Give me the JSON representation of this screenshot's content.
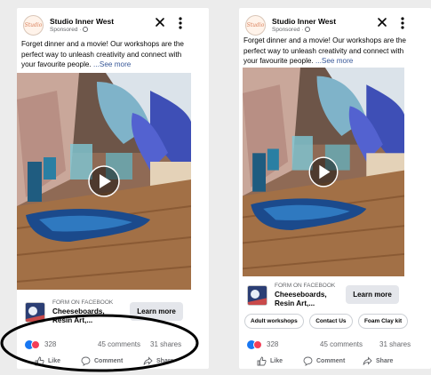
{
  "colors": {
    "page_bg": "#ececec",
    "card_bg": "#ffffff",
    "link": "#385898",
    "muted": "#65676b",
    "button_bg": "#e4e6eb",
    "like_blue": "#1877f2",
    "love_red": "#f33e58",
    "annotation": "#000000"
  },
  "ad_left": {
    "page_name": "Studio Inner West",
    "sponsored": "Sponsored ·",
    "logo_text": "Studio",
    "caption": "Forget dinner and a movie! Our workshops are the perfect way to unleash creativity and connect with your favourite people.",
    "see_more": "...See more",
    "form_source": "FORM ON FACEBOOK",
    "form_title": "Cheeseboards, Resin Art,...",
    "learn_more": "Learn more",
    "reaction_count": "328",
    "comments": "45 comments",
    "shares": "31 shares",
    "like_label": "Like",
    "comment_label": "Comment",
    "share_label": "Share"
  },
  "ad_right": {
    "page_name": "Studio Inner West",
    "sponsored": "Sponsored ·",
    "logo_text": "Studio",
    "caption": "Forget dinner and a movie! Our workshops are the perfect way to unleash creativity and connect with your favourite people.",
    "see_more": "...See more",
    "form_source": "FORM ON FACEBOOK",
    "form_title": "Cheeseboards, Resin Art,...",
    "learn_more": "Learn more",
    "chips": [
      "Adult workshops",
      "Contact Us",
      "Foam Clay kit"
    ],
    "reaction_count": "328",
    "comments": "45 comments",
    "shares": "31 shares",
    "like_label": "Like",
    "comment_label": "Comment",
    "share_label": "Share"
  },
  "icons": [
    "close-icon",
    "more-options-icon",
    "globe-icon",
    "play-icon",
    "like-reaction-icon",
    "love-reaction-icon",
    "like-icon",
    "comment-icon",
    "share-icon"
  ]
}
